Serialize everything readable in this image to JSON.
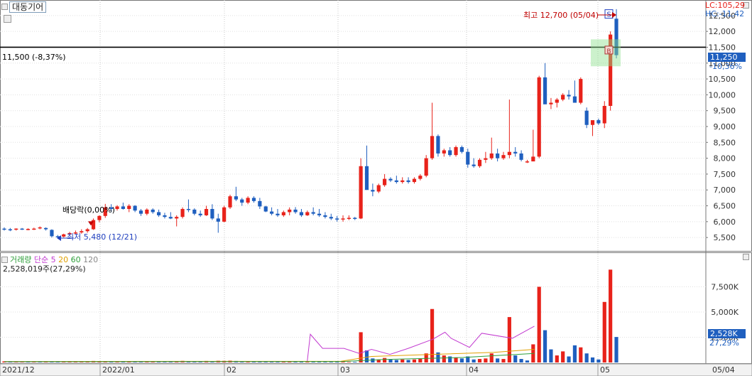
{
  "header": {
    "stock_name": "대동기어",
    "lc_label": "LC:105,29",
    "hc_label": "HC:-11,42"
  },
  "annotations": {
    "high": "최고 12,700 (05/04)",
    "low": "최저 5,480 (12/21)",
    "dividend": "배당락(0,00%)",
    "hline": "11,500 (-8,37%)",
    "current_price": "11,250",
    "current_pct": "-10,36%",
    "sell_marker": "S",
    "buy_marker": "B"
  },
  "volume_legend": {
    "title": "거래량",
    "ma_label": "단순",
    "ma5": "5",
    "ma20": "20",
    "ma60": "60",
    "ma120": "120",
    "value": "2,528,019주(27,29%)",
    "current_value": "2,528K",
    "current_pct": "27,29%"
  },
  "colors": {
    "up": "#e8221a",
    "down": "#1f5fbf",
    "ma5": "#c23bd0",
    "ma20": "#e0a000",
    "ma60": "#2e9e3a",
    "ma120": "#888888",
    "hline": "#000000"
  },
  "chart_data": [
    {
      "type": "candlestick",
      "title": "대동기어",
      "price_axis": [
        "5,500",
        "6,000",
        "6,500",
        "7,000",
        "7,500",
        "8,000",
        "8,500",
        "9,000",
        "9,500",
        "10,000",
        "10,500",
        "11,000",
        "11,500",
        "12,000",
        "12,500"
      ],
      "ylim": [
        5100,
        12900
      ],
      "x_ticks": [
        "2021/12",
        "2022/01",
        "02",
        "03",
        "04",
        "05",
        "05/04"
      ],
      "ohlc": [
        [
          5780,
          5820,
          5720,
          5760
        ],
        [
          5760,
          5800,
          5700,
          5740
        ],
        [
          5760,
          5790,
          5720,
          5780
        ],
        [
          5780,
          5800,
          5740,
          5760
        ],
        [
          5760,
          5790,
          5730,
          5770
        ],
        [
          5770,
          5810,
          5740,
          5780
        ],
        [
          5800,
          5850,
          5760,
          5820
        ],
        [
          5800,
          5820,
          5720,
          5760
        ],
        [
          5740,
          5760,
          5500,
          5540
        ],
        [
          5540,
          5580,
          5480,
          5530
        ],
        [
          5530,
          5620,
          5500,
          5600
        ],
        [
          5600,
          5680,
          5560,
          5640
        ],
        [
          5640,
          5720,
          5600,
          5660
        ],
        [
          5660,
          5760,
          5620,
          5700
        ],
        [
          5700,
          5800,
          5650,
          5760
        ],
        [
          5760,
          6100,
          5740,
          6050
        ],
        [
          6050,
          6200,
          5980,
          6180
        ],
        [
          6180,
          6560,
          6120,
          6450
        ],
        [
          6450,
          6550,
          6300,
          6400
        ],
        [
          6400,
          6520,
          6350,
          6480
        ],
        [
          6480,
          6600,
          6380,
          6400
        ],
        [
          6400,
          6550,
          6300,
          6500
        ],
        [
          6500,
          6520,
          6300,
          6350
        ],
        [
          6350,
          6400,
          6180,
          6250
        ],
        [
          6250,
          6420,
          6200,
          6380
        ],
        [
          6380,
          6420,
          6250,
          6300
        ],
        [
          6300,
          6380,
          6150,
          6200
        ],
        [
          6200,
          6280,
          6100,
          6150
        ],
        [
          6150,
          6300,
          6080,
          6100
        ],
        [
          6100,
          6200,
          5850,
          6150
        ],
        [
          6150,
          6450,
          6100,
          6400
        ],
        [
          6400,
          6700,
          6300,
          6380
        ],
        [
          6380,
          6420,
          6200,
          6250
        ],
        [
          6250,
          6350,
          6150,
          6200
        ],
        [
          6200,
          6500,
          6180,
          6400
        ],
        [
          6400,
          6550,
          6050,
          6100
        ],
        [
          6100,
          6250,
          5650,
          6000
        ],
        [
          6000,
          6500,
          5980,
          6450
        ],
        [
          6450,
          6850,
          6400,
          6800
        ],
        [
          6800,
          7100,
          6650,
          6700
        ],
        [
          6700,
          6750,
          6500,
          6600
        ],
        [
          6600,
          6800,
          6550,
          6750
        ],
        [
          6750,
          6800,
          6600,
          6650
        ],
        [
          6650,
          6750,
          6400,
          6480
        ],
        [
          6480,
          6500,
          6300,
          6320
        ],
        [
          6320,
          6450,
          6200,
          6250
        ],
        [
          6250,
          6400,
          6150,
          6200
        ],
        [
          6200,
          6350,
          6150,
          6300
        ],
        [
          6300,
          6450,
          6200,
          6380
        ],
        [
          6380,
          6460,
          6250,
          6300
        ],
        [
          6300,
          6400,
          6150,
          6200
        ],
        [
          6200,
          6350,
          6180,
          6300
        ],
        [
          6300,
          6450,
          6200,
          6250
        ],
        [
          6250,
          6400,
          6150,
          6200
        ],
        [
          6200,
          6300,
          6100,
          6150
        ],
        [
          6150,
          6250,
          6050,
          6100
        ],
        [
          6100,
          6180,
          6000,
          6080
        ],
        [
          6080,
          6200,
          6000,
          6100
        ],
        [
          6100,
          6200,
          6050,
          6120
        ],
        [
          6120,
          6150,
          6050,
          6100
        ],
        [
          6100,
          8000,
          6080,
          7750
        ],
        [
          7750,
          8400,
          7200,
          7000
        ],
        [
          7000,
          7200,
          6800,
          6950
        ],
        [
          6950,
          7200,
          6900,
          7150
        ],
        [
          7150,
          7500,
          7100,
          7350
        ],
        [
          7350,
          7400,
          7250,
          7300
        ],
        [
          7300,
          7450,
          7200,
          7250
        ],
        [
          7250,
          7400,
          7200,
          7300
        ],
        [
          7300,
          7400,
          7200,
          7250
        ],
        [
          7250,
          7400,
          7200,
          7350
        ],
        [
          7350,
          7500,
          7300,
          7450
        ],
        [
          7450,
          8100,
          7400,
          8000
        ],
        [
          8000,
          9750,
          7950,
          8700
        ],
        [
          8700,
          8750,
          8050,
          8150
        ],
        [
          8150,
          8300,
          8050,
          8250
        ],
        [
          8250,
          8350,
          8050,
          8100
        ],
        [
          8100,
          8400,
          8050,
          8350
        ],
        [
          8350,
          8400,
          8150,
          8200
        ],
        [
          8200,
          8300,
          7700,
          7800
        ],
        [
          7800,
          8000,
          7700,
          7750
        ],
        [
          7750,
          8000,
          7700,
          7950
        ],
        [
          7950,
          8200,
          7850,
          8000
        ],
        [
          8000,
          8650,
          7950,
          8150
        ],
        [
          8150,
          8300,
          7900,
          8000
        ],
        [
          8000,
          8200,
          7950,
          8100
        ],
        [
          8100,
          9850,
          8000,
          8200
        ],
        [
          8200,
          8350,
          8050,
          8150
        ],
        [
          8150,
          8250,
          7900,
          7950
        ],
        [
          7900,
          7950,
          7850,
          7900
        ],
        [
          7900,
          8900,
          7950,
          8050
        ],
        [
          8050,
          10600,
          8000,
          10550
        ],
        [
          10550,
          11000,
          9800,
          9700
        ],
        [
          9700,
          9900,
          9550,
          9750
        ],
        [
          9750,
          9900,
          9600,
          9850
        ],
        [
          9850,
          10050,
          9800,
          10000
        ],
        [
          10000,
          10150,
          9850,
          9950
        ],
        [
          9950,
          10450,
          9900,
          9750
        ],
        [
          9750,
          10550,
          9700,
          10500
        ],
        [
          9500,
          9600,
          8950,
          9050
        ],
        [
          9050,
          9100,
          8700,
          9200
        ],
        [
          9200,
          9250,
          9050,
          9100
        ],
        [
          9100,
          9800,
          8950,
          9650
        ],
        [
          9650,
          12000,
          9500,
          11900
        ],
        [
          12400,
          12700,
          11150,
          11250
        ]
      ],
      "hline": 11500
    },
    {
      "type": "bar",
      "title": "거래량",
      "volume_axis": [
        "2,500K",
        "5,000K",
        "7,500K"
      ],
      "ylim": [
        0,
        10000
      ],
      "volumes": [
        [
          110,
          "up"
        ],
        [
          90,
          "down"
        ],
        [
          80,
          "up"
        ],
        [
          90,
          "up"
        ],
        [
          70,
          "down"
        ],
        [
          85,
          "up"
        ],
        [
          70,
          "down"
        ],
        [
          60,
          "up"
        ],
        [
          120,
          "down"
        ],
        [
          90,
          "down"
        ],
        [
          100,
          "up"
        ],
        [
          90,
          "up"
        ],
        [
          80,
          "up"
        ],
        [
          110,
          "up"
        ],
        [
          130,
          "up"
        ],
        [
          150,
          "up"
        ],
        [
          130,
          "up"
        ],
        [
          140,
          "up"
        ],
        [
          120,
          "down"
        ],
        [
          100,
          "up"
        ],
        [
          90,
          "down"
        ],
        [
          100,
          "up"
        ],
        [
          80,
          "down"
        ],
        [
          90,
          "down"
        ],
        [
          120,
          "up"
        ],
        [
          100,
          "up"
        ],
        [
          110,
          "down"
        ],
        [
          90,
          "down"
        ],
        [
          100,
          "down"
        ],
        [
          140,
          "up"
        ],
        [
          160,
          "up"
        ],
        [
          130,
          "down"
        ],
        [
          120,
          "down"
        ],
        [
          110,
          "down"
        ],
        [
          150,
          "up"
        ],
        [
          140,
          "down"
        ],
        [
          170,
          "up"
        ],
        [
          160,
          "up"
        ],
        [
          180,
          "up"
        ],
        [
          150,
          "down"
        ],
        [
          120,
          "down"
        ],
        [
          110,
          "up"
        ],
        [
          100,
          "down"
        ],
        [
          90,
          "down"
        ],
        [
          80,
          "down"
        ],
        [
          80,
          "down"
        ],
        [
          80,
          "down"
        ],
        [
          70,
          "up"
        ],
        [
          80,
          "up"
        ],
        [
          70,
          "down"
        ],
        [
          70,
          "down"
        ],
        [
          60,
          "up"
        ],
        [
          60,
          "down"
        ],
        [
          60,
          "down"
        ],
        [
          60,
          "down"
        ],
        [
          60,
          "down"
        ],
        [
          60,
          "down"
        ],
        [
          60,
          "up"
        ],
        [
          50,
          "up"
        ],
        [
          60,
          "down"
        ],
        [
          3000,
          "up"
        ],
        [
          1200,
          "down"
        ],
        [
          400,
          "down"
        ],
        [
          300,
          "up"
        ],
        [
          450,
          "up"
        ],
        [
          300,
          "down"
        ],
        [
          250,
          "down"
        ],
        [
          300,
          "up"
        ],
        [
          250,
          "down"
        ],
        [
          300,
          "up"
        ],
        [
          350,
          "up"
        ],
        [
          900,
          "up"
        ],
        [
          5300,
          "up"
        ],
        [
          1000,
          "down"
        ],
        [
          700,
          "up"
        ],
        [
          600,
          "down"
        ],
        [
          500,
          "up"
        ],
        [
          400,
          "down"
        ],
        [
          600,
          "down"
        ],
        [
          300,
          "down"
        ],
        [
          350,
          "up"
        ],
        [
          400,
          "up"
        ],
        [
          900,
          "up"
        ],
        [
          400,
          "down"
        ],
        [
          350,
          "up"
        ],
        [
          4500,
          "up"
        ],
        [
          700,
          "down"
        ],
        [
          350,
          "down"
        ],
        [
          200,
          "down"
        ],
        [
          1800,
          "up"
        ],
        [
          7500,
          "up"
        ],
        [
          3200,
          "down"
        ],
        [
          1300,
          "down"
        ],
        [
          700,
          "up"
        ],
        [
          1100,
          "up"
        ],
        [
          600,
          "down"
        ],
        [
          1700,
          "down"
        ],
        [
          1500,
          "up"
        ],
        [
          900,
          "down"
        ],
        [
          500,
          "down"
        ],
        [
          300,
          "down"
        ],
        [
          6000,
          "up"
        ],
        [
          9200,
          "up"
        ],
        [
          2528,
          "down"
        ]
      ],
      "ma5": [
        [
          60,
          0
        ],
        [
          90,
          0
        ],
        [
          100,
          0
        ],
        [
          110,
          0
        ],
        [
          2800,
          0
        ],
        [
          1400,
          0
        ],
        [
          1400,
          0
        ],
        [
          900,
          0
        ],
        [
          1300,
          0
        ],
        [
          800,
          0
        ],
        [
          1400,
          0
        ],
        [
          2300,
          0
        ],
        [
          3000,
          0
        ],
        [
          2400,
          0
        ],
        [
          1500,
          0
        ],
        [
          2900,
          0
        ],
        [
          2400,
          0
        ],
        [
          3600,
          0
        ]
      ],
      "ma5_x": [
        0,
        0.46,
        0.48,
        0.495,
        0.5,
        0.52,
        0.555,
        0.58,
        0.6,
        0.63,
        0.66,
        0.7,
        0.72,
        0.73,
        0.76,
        0.78,
        0.83,
        0.866
      ]
    }
  ]
}
